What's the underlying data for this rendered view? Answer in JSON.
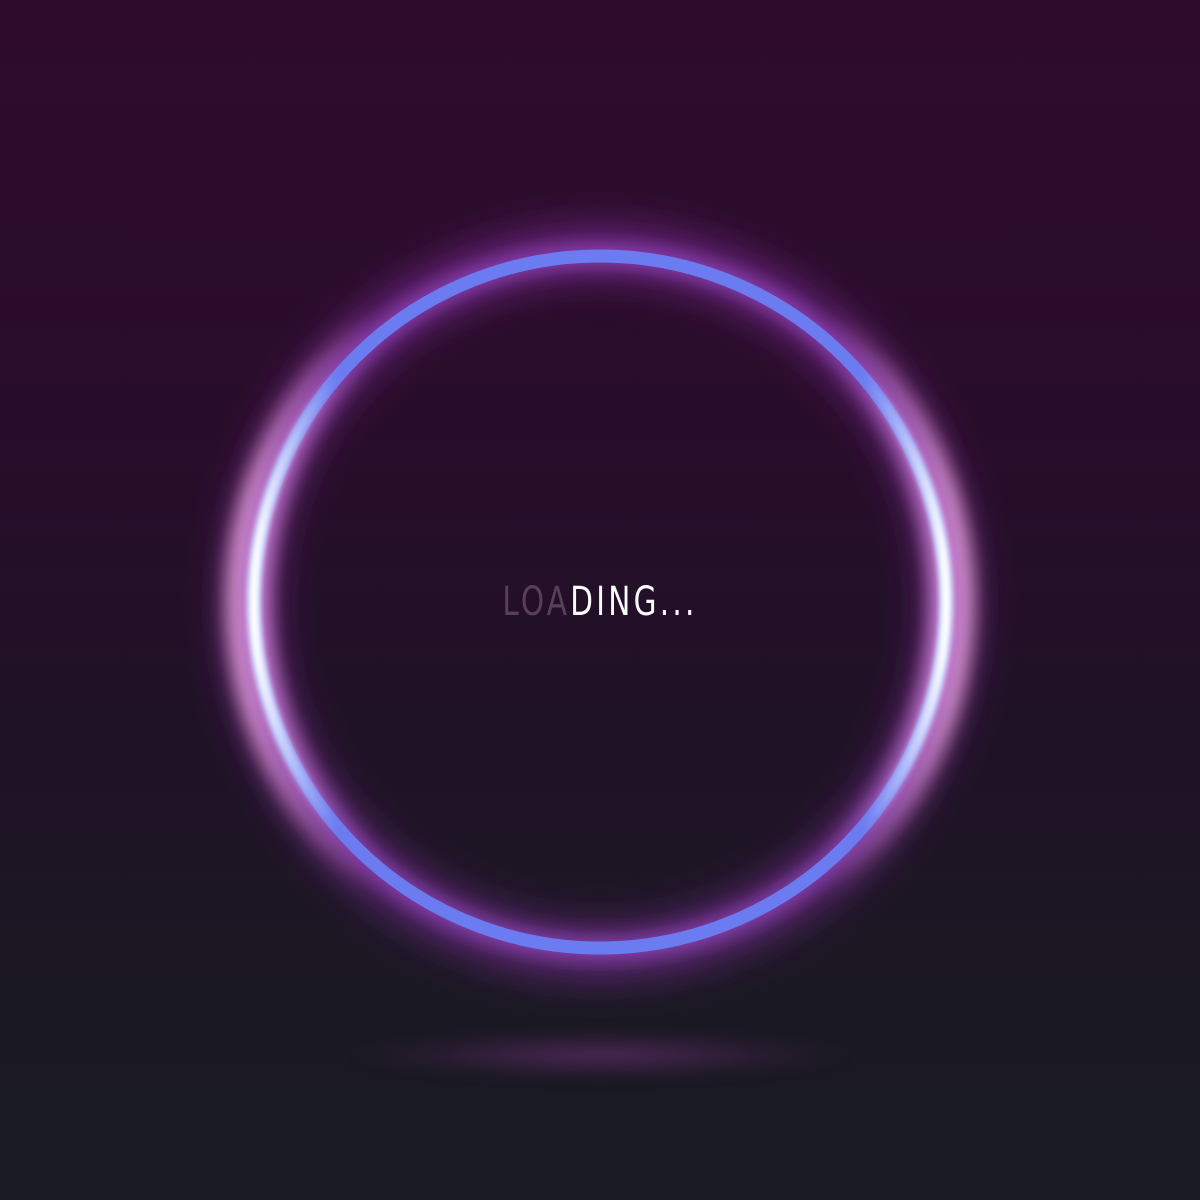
{
  "loader": {
    "text_dim": "LOA",
    "text_bright": "DING...",
    "ring_color": "#6b7cf0",
    "highlight_color": "#ffffff",
    "glow_color": "#a040c0",
    "background_top": "#2e0b2c",
    "background_bottom": "#1a1a22"
  }
}
